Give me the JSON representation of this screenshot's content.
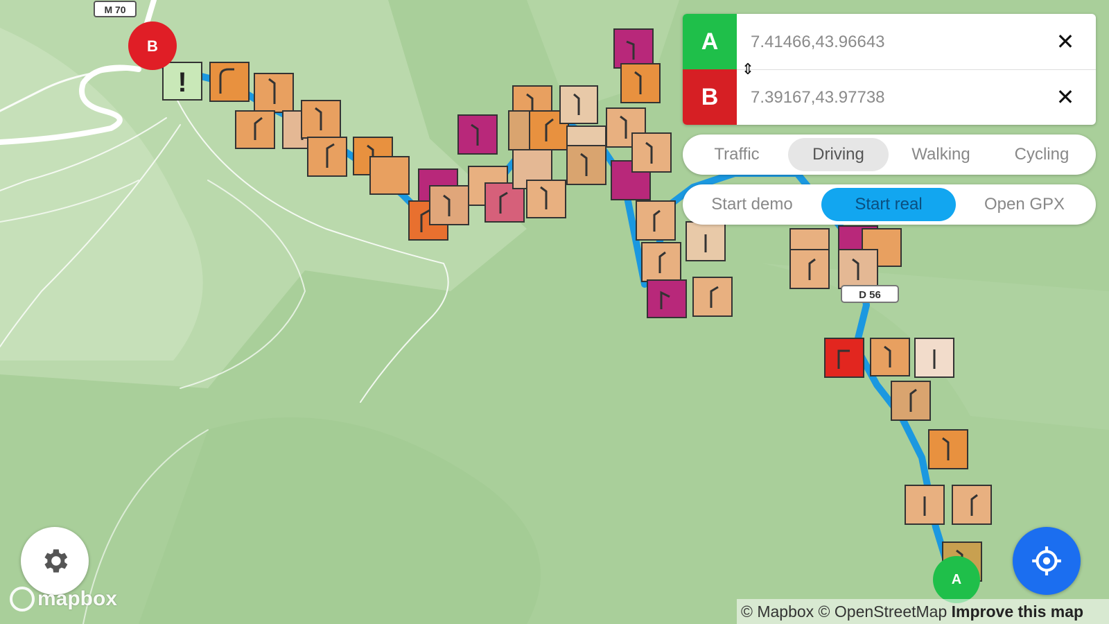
{
  "map": {
    "road_shields": {
      "top_left": "M 70",
      "lower_right": "D 56"
    },
    "markers": {
      "start": "A",
      "end": "B"
    },
    "warning_glyph": "!",
    "colors": {
      "land": "#a9cf9a",
      "land_light": "#c4dfb6",
      "route": "#1b98e0",
      "road": "#ffffff",
      "end_marker": "#e01e26",
      "start_marker": "#1fbf4a",
      "traffic_orange": "#e8913f",
      "traffic_tan": "#d9a46f",
      "traffic_magenta": "#b8287a",
      "traffic_red": "#e2261f",
      "traffic_light": "#e8c9a8"
    }
  },
  "directions": {
    "origin": {
      "badge": "A",
      "value": "7.41466,43.96643",
      "color": "#1fbf4a"
    },
    "destination": {
      "badge": "B",
      "value": "7.39167,43.97738",
      "color": "#d61f24"
    },
    "close_glyph": "✕",
    "swap_glyph": "⇕"
  },
  "profiles": {
    "items": [
      "Traffic",
      "Driving",
      "Walking",
      "Cycling"
    ],
    "selected": "Driving"
  },
  "actions": {
    "items": [
      "Start demo",
      "Start real",
      "Open GPX"
    ],
    "selected": "Start real",
    "accent": "#12a6f0"
  },
  "buttons": {
    "settings_icon": "gear-icon",
    "locate_icon": "crosshair-icon"
  },
  "branding": {
    "logo_text": "mapbox"
  },
  "attribution": {
    "text": "© Mapbox © OpenStreetMap",
    "improve": "Improve this map"
  }
}
